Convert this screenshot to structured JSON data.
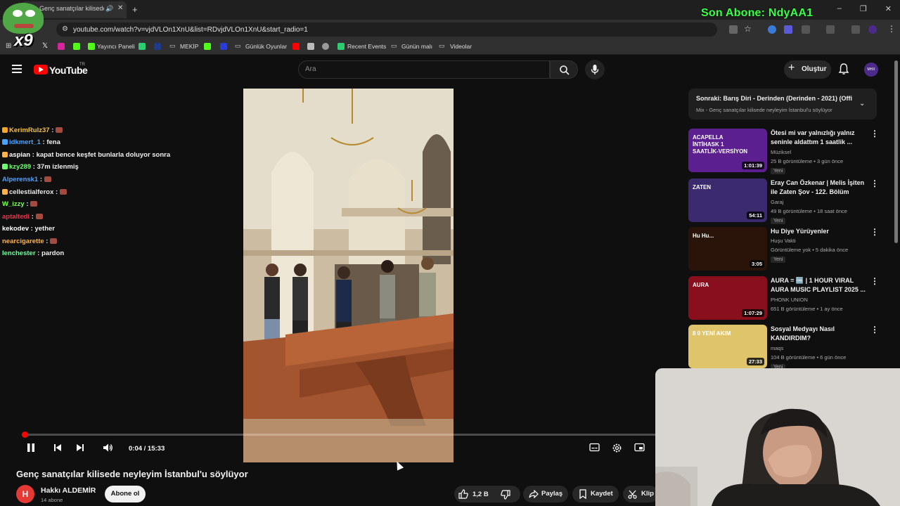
{
  "browser": {
    "tab_title": "Genç sanatçılar kilisede ney",
    "url": "youtube.com/watch?v=vjdVLOn1XnU&list=RDvjdVLOn1XnU&start_radio=1",
    "new_tab": "+",
    "window_controls": [
      "–",
      "❐",
      "✕"
    ],
    "bookmarks": [
      "Yayıncı Paneli",
      "MEKİP",
      "Günlük Oyunlar",
      "Recent Events",
      "Günün malı",
      "Videolar"
    ]
  },
  "stream_overlay": {
    "last_subscriber": "Son Abone: NdyAA1",
    "multiplier": "x9"
  },
  "header": {
    "logo_text": "YouTube",
    "region": "TR",
    "search_placeholder": "Ara",
    "create_label": "Oluştur",
    "avatar_text": "MHX"
  },
  "chat": [
    {
      "nick": "KerimRulz37",
      "color": "#f5c242",
      "msg": ""
    },
    {
      "nick": "idkmert_1",
      "color": "#4aa3ff",
      "msg": "fena"
    },
    {
      "nick": "aspian",
      "color": "#ffffff",
      "msg": "kapat bence keşfet bunlarla doluyor sonra"
    },
    {
      "nick": "kzy289",
      "color": "#6dff6d",
      "msg": "37m izlenmiş"
    },
    {
      "nick": "Alperensk1",
      "color": "#4aa3ff",
      "msg": ""
    },
    {
      "nick": "cellestialferox",
      "color": "#e9e9e9",
      "msg": ""
    },
    {
      "nick": "W_izzy",
      "color": "#7dff5a",
      "msg": ""
    },
    {
      "nick": "aptaltedi",
      "color": "#e8344a",
      "msg": ""
    },
    {
      "nick": "kekodev",
      "color": "#ffffff",
      "msg": "yether"
    },
    {
      "nick": "nearcigarette",
      "color": "#ffb347",
      "msg": ""
    },
    {
      "nick": "lenchester",
      "color": "#6dff9a",
      "msg": "pardon"
    }
  ],
  "player": {
    "time": "0:04 / 15:33",
    "progress": 0.004,
    "title": "Genç sanatçılar kilisede neyleyim İstanbul'u söylüyor",
    "channel": "Hakkı ALDEMİR",
    "channel_initial": "H",
    "subscribers": "14 abone",
    "subscribe_label": "Abone ol",
    "likes": "1,2 B",
    "share_label": "Paylaş",
    "save_label": "Kaydet",
    "clip_label": "Klip"
  },
  "up_next": {
    "title": "Sonraki: Barış Diri - Derinden (Derinden - 2021) (Offi...",
    "subtitle": "Mix - Genç sanatçılar kilisede neyleyim İstanbul'u söylüyor"
  },
  "recommendations": [
    {
      "title": "Ötesi mi var yalnızlığı yalnız seninle aldattım 1 saatlik ...",
      "channel": "Müziksel",
      "meta": "25 B görüntüleme • 3 gün önce",
      "badge": "Yeni",
      "duration": "1:01:39",
      "thumb_text": "ACAPELLA İNTİHASK 1 SAATLİK-VERSİYON",
      "thumb_color": "#5b1f8f"
    },
    {
      "title": "Eray Can Özkenar | Melis İşiten ile Zaten Şov - 122. Bölüm",
      "channel": "Garaj",
      "meta": "49 B görüntüleme • 18 saat önce",
      "badge": "Yeni",
      "duration": "54:11",
      "thumb_text": "ZATEN",
      "thumb_color": "#3b2a6e"
    },
    {
      "title": "Hu Diye Yürüyenler",
      "channel": "Huşu Vakti",
      "meta": "Görüntüleme yok • 5 dakika önce",
      "badge": "Yeni",
      "duration": "3:05",
      "thumb_text": "Hu Hu...",
      "thumb_color": "#2a140a"
    },
    {
      "title": "AURA = 🆒 | 1 HOUR VIRAL AURA MUSIC PLAYLIST 2025 ...",
      "channel": "PHONK UNION",
      "meta": "651 B görüntüleme • 1 ay önce",
      "badge": "",
      "duration": "1:07:29",
      "thumb_text": "AURA",
      "thumb_color": "#8a0f1c"
    },
    {
      "title": "Sosyal Medyayı Nasıl KANDIRDIM?",
      "channel": "maqs",
      "meta": "104 B görüntüleme • 6 gün önce",
      "badge": "Yeni",
      "duration": "27:33",
      "thumb_text": "8 0 YENİ AKIM",
      "thumb_color": "#e0c46a"
    }
  ]
}
